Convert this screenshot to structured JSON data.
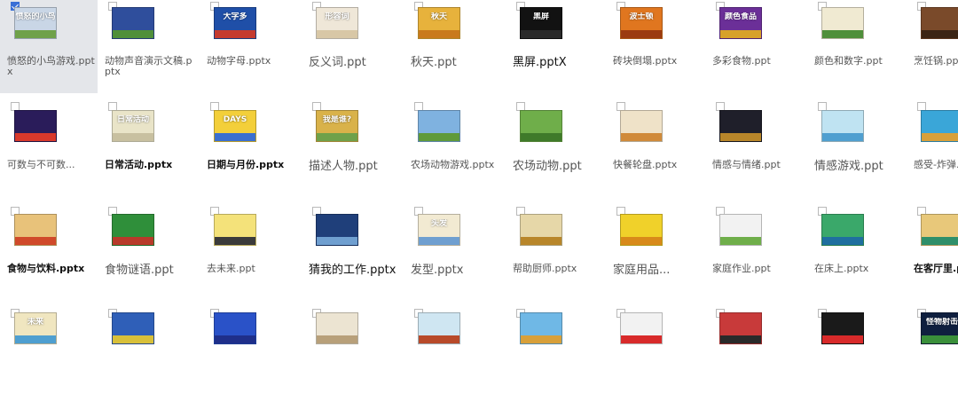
{
  "files": [
    {
      "name": "愤怒的小鸟游戏.pptx",
      "thumb_text": "愤怒的小鸟",
      "bg": "#c9d6e6",
      "band": "#6fa14a",
      "selected": true,
      "checked": true,
      "style": "s"
    },
    {
      "name": "动物声音演示文稿.pptx",
      "thumb_text": "",
      "bg": "#2f4e9c",
      "band": "#4f8f3a",
      "style": "s"
    },
    {
      "name": "动物字母.pptx",
      "thumb_text": "大字多",
      "bg": "#1f4fa8",
      "band": "#c43a2f",
      "style": "s"
    },
    {
      "name": "反义词.ppt",
      "thumb_text": "形容词",
      "bg": "#efe7d8",
      "band": "#d8c7a6",
      "style": "l"
    },
    {
      "name": "秋天.ppt",
      "thumb_text": "秋天",
      "bg": "#e7b23c",
      "band": "#c97a1d",
      "style": "l"
    },
    {
      "name": "黑屏.pptX",
      "thumb_text": "黑屏",
      "bg": "#121212",
      "band": "#2a2a2a",
      "style": "l dark"
    },
    {
      "name": "砖块倒塌.pptx",
      "thumb_text": "波士顿",
      "bg": "#e0761f",
      "band": "#9b3b10",
      "style": "s"
    },
    {
      "name": "多彩食物.ppt",
      "thumb_text": "颜色食品",
      "bg": "#6b2f98",
      "band": "#d7a12a",
      "style": "s"
    },
    {
      "name": "颜色和数字.ppt",
      "thumb_text": "",
      "bg": "#f0ead2",
      "band": "#4f8f3a",
      "style": "s"
    },
    {
      "name": "烹饪锅.pptx",
      "thumb_text": "",
      "bg": "#7a4a2a",
      "band": "#3b2414",
      "style": "s"
    },
    {
      "name": "可数与不可数...",
      "thumb_text": "",
      "bg": "#2a1c5a",
      "band": "#d8392b",
      "style": "s"
    },
    {
      "name": "日常活动.pptx",
      "thumb_text": "日常活动",
      "bg": "#e9e4c8",
      "band": "#c8c0a0",
      "style": "s bold"
    },
    {
      "name": "日期与月份.pptx",
      "thumb_text": "DAYS",
      "bg": "#f3cf3a",
      "band": "#3b6fcf",
      "style": "s bold"
    },
    {
      "name": "描述人物.ppt",
      "thumb_text": "我是谁?",
      "bg": "#d9b24a",
      "band": "#6fa14a",
      "style": "l"
    },
    {
      "name": "农场动物游戏.pptx",
      "thumb_text": "",
      "bg": "#7fb2e0",
      "band": "#5f9a3a",
      "style": "s"
    },
    {
      "name": "农场动物.ppt",
      "thumb_text": "",
      "bg": "#6fae4a",
      "band": "#3f7a2a",
      "style": "l"
    },
    {
      "name": "快餐轮盘.pptx",
      "thumb_text": "",
      "bg": "#efe2c8",
      "band": "#d08a3a",
      "style": "s"
    },
    {
      "name": "情感与情绪.ppt",
      "thumb_text": "",
      "bg": "#1f1f2a",
      "band": "#b8862a",
      "style": "s"
    },
    {
      "name": "情感游戏.ppt",
      "thumb_text": "",
      "bg": "#bfe3f2",
      "band": "#4f9fd0",
      "style": "l"
    },
    {
      "name": "感受-炸弹...",
      "thumb_text": "",
      "bg": "#3aa6d8",
      "band": "#d8a03a",
      "style": "s"
    },
    {
      "name": "食物与饮料.pptx",
      "thumb_text": "",
      "bg": "#e8c27a",
      "band": "#d04a2a",
      "style": "s bold"
    },
    {
      "name": "食物谜语.ppt",
      "thumb_text": "",
      "bg": "#2f8f3a",
      "band": "#b83a2a",
      "style": "l"
    },
    {
      "name": "去未来.ppt",
      "thumb_text": "",
      "bg": "#f4e27a",
      "band": "#3b3b3b",
      "style": "s"
    },
    {
      "name": "猜我的工作.pptx",
      "thumb_text": "",
      "bg": "#1f3f7a",
      "band": "#6f9fd0",
      "style": "l dark"
    },
    {
      "name": "发型.pptx",
      "thumb_text": "头发",
      "bg": "#f2ead2",
      "band": "#6f9fd0",
      "style": "l"
    },
    {
      "name": "帮助厨师.pptx",
      "thumb_text": "",
      "bg": "#e6d7a8",
      "band": "#b8862a",
      "style": "s"
    },
    {
      "name": "家庭用品...",
      "thumb_text": "",
      "bg": "#f0d12a",
      "band": "#d88a1a",
      "style": "l"
    },
    {
      "name": "家庭作业.ppt",
      "thumb_text": "",
      "bg": "#f2f2f2",
      "band": "#6fae4a",
      "style": "s"
    },
    {
      "name": "在床上.pptx",
      "thumb_text": "",
      "bg": "#3aa86a",
      "band": "#1f6f9f",
      "style": "s"
    },
    {
      "name": "在客厅里.pptx",
      "thumb_text": "",
      "bg": "#e8c87a",
      "band": "#2f8f6a",
      "style": "s bold"
    },
    {
      "name": "",
      "thumb_text": "未来",
      "bg": "#f0e6c0",
      "band": "#4f9fd0",
      "style": "s"
    },
    {
      "name": "",
      "thumb_text": "",
      "bg": "#2f5fb8",
      "band": "#d8c03a",
      "style": "s"
    },
    {
      "name": "",
      "thumb_text": "",
      "bg": "#2a52c8",
      "band": "#1f2f8a",
      "style": "s"
    },
    {
      "name": "",
      "thumb_text": "",
      "bg": "#ece4d2",
      "band": "#b8a07a",
      "style": "s"
    },
    {
      "name": "",
      "thumb_text": "",
      "bg": "#cfe6f2",
      "band": "#b84a2a",
      "style": "s"
    },
    {
      "name": "",
      "thumb_text": "",
      "bg": "#6fb8e6",
      "band": "#d8a03a",
      "style": "s"
    },
    {
      "name": "",
      "thumb_text": "",
      "bg": "#f2f2f2",
      "band": "#d82a2a",
      "style": "s"
    },
    {
      "name": "",
      "thumb_text": "",
      "bg": "#c83a3a",
      "band": "#2a2a2a",
      "style": "s"
    },
    {
      "name": "",
      "thumb_text": "",
      "bg": "#1a1a1a",
      "band": "#d82a2a",
      "style": "s"
    },
    {
      "name": "",
      "thumb_text": "怪物射击",
      "bg": "#0f1f3f",
      "band": "#3a8f3a",
      "style": "s"
    }
  ]
}
